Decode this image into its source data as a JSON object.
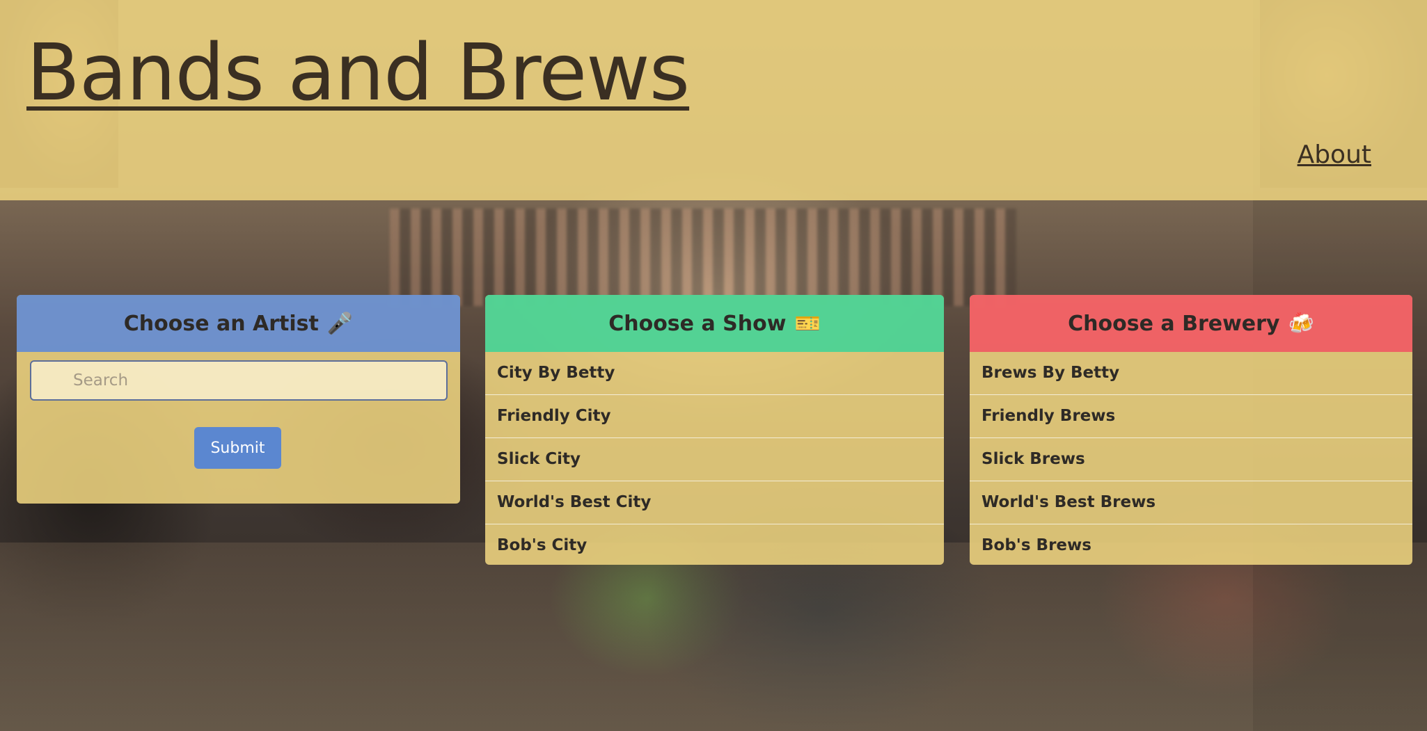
{
  "site": {
    "title": "Bands and Brews",
    "nav_about": "About"
  },
  "artist_card": {
    "heading": "Choose an Artist",
    "heading_icon": "microphone-icon",
    "heading_emoji": "🎤",
    "search_placeholder": "Search",
    "search_value": "",
    "submit_label": "Submit",
    "header_color": "#648cd2"
  },
  "show_card": {
    "heading": "Choose a Show",
    "heading_icon": "ticket-icon",
    "heading_emoji": "🎫",
    "header_color": "#46d296",
    "items": [
      {
        "label": "City By Betty"
      },
      {
        "label": "Friendly City"
      },
      {
        "label": "Slick City"
      },
      {
        "label": "World's Best City"
      },
      {
        "label": "Bob's City"
      }
    ]
  },
  "brewery_card": {
    "heading": "Choose a Brewery",
    "heading_icon": "beer-mugs-icon",
    "heading_emoji": "🍻",
    "header_color": "#f05a64",
    "items": [
      {
        "label": "Brews By Betty"
      },
      {
        "label": "Friendly Brews"
      },
      {
        "label": "Slick Brews"
      },
      {
        "label": "World's Best Brews"
      },
      {
        "label": "Bob's Brews"
      }
    ]
  },
  "colors": {
    "overlay_yellow": "#eed480",
    "submit_blue": "#5b87d0",
    "text_dark": "#2e2a26"
  },
  "background_image": "concert-photo"
}
